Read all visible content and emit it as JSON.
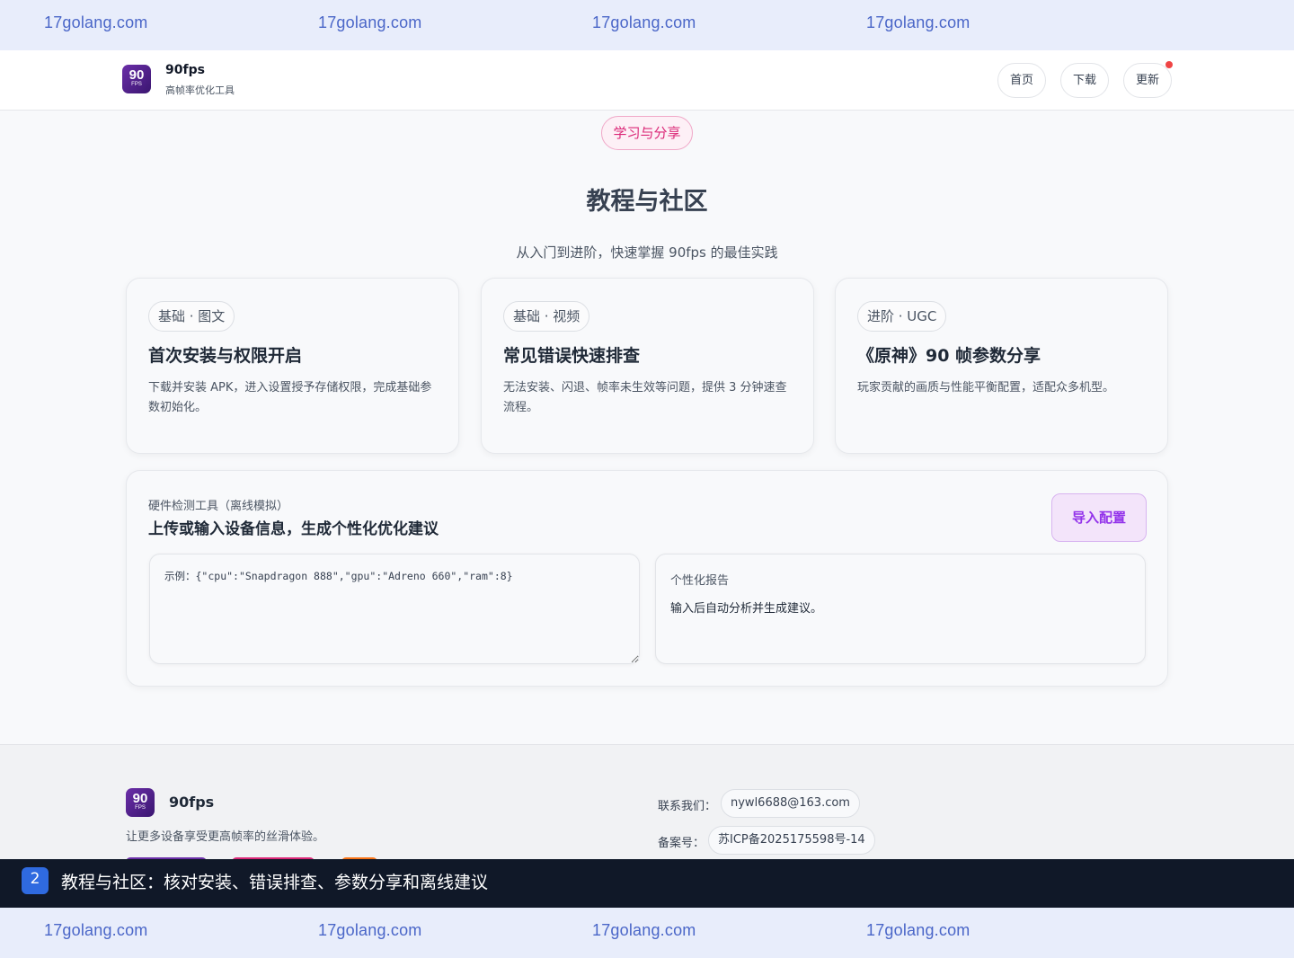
{
  "watermark": {
    "text": [
      "17golang.com",
      "17golang.com",
      "17golang.com",
      "17golang.com"
    ],
    "color": "#4a66c8"
  },
  "header": {
    "logo_num": "90",
    "logo_sub": "FPS",
    "brand_name": "90fps",
    "brand_subtitle": "高帧率优化工具",
    "nav": [
      "首页",
      "下载",
      "更新"
    ],
    "update_dot_color": "#ef4444"
  },
  "section": {
    "pill": "学习与分享",
    "title": "教程与社区",
    "subtitle": "从入门到进阶，快速掌握 90fps 的最佳实践"
  },
  "cards": [
    {
      "tag": "基础 · 图文",
      "title": "首次安装与权限开启",
      "desc": "下载并安装 APK，进入设置授予存储权限，完成基础参数初始化。"
    },
    {
      "tag": "基础 · 视频",
      "title": "常见错误快速排查",
      "desc": "无法安装、闪退、帧率未生效等问题，提供 3 分钟速查流程。"
    },
    {
      "tag": "进阶 · UGC",
      "title": "《原神》90 帧参数分享",
      "desc": "玩家贡献的画质与性能平衡配置，适配众多机型。"
    }
  ],
  "tool": {
    "label": "硬件检测工具（离线模拟）",
    "title": "上传或输入设备信息，生成个性化优化建议",
    "import_button": "导入配置",
    "input_placeholder": "示例：{\"cpu\":\"Snapdragon 888\",\"gpu\":\"Adreno 660\",\"ram\":8}",
    "report_label": "个性化报告",
    "report_text": "输入后自动分析并生成建议。"
  },
  "footer": {
    "brand_name": "90fps",
    "slogan": "让更多设备享受更高帧率的丝滑体验。",
    "contact_label": "联系我们：",
    "contact_value": "nywl6688@163.com",
    "icp_label": "备案号：",
    "icp_value": "苏ICP备2025175598号-14"
  },
  "caption": {
    "number": "2",
    "text": "教程与社区：核对安装、错误排查、参数分享和离线建议"
  }
}
